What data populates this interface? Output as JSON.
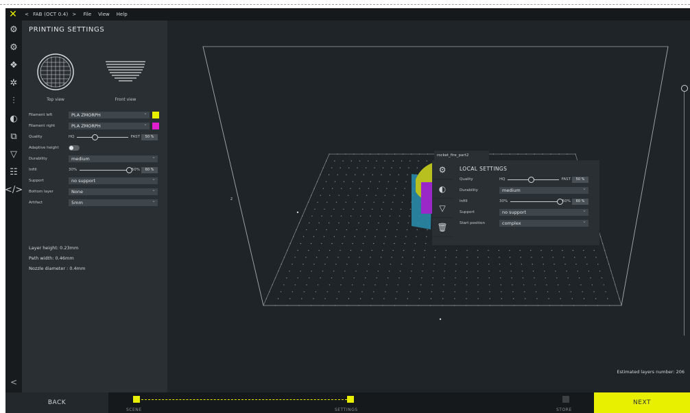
{
  "menubar": {
    "crumb_prefix": "<",
    "project": "FAB (OCT 0.4)",
    "crumb_sep": ">",
    "menus": [
      "File",
      "View",
      "Help"
    ]
  },
  "rail": {
    "icons": [
      "gear-icon",
      "gear-sub-icon",
      "model-settings-icon",
      "multi-gear-icon",
      "support-tree-icon",
      "palette-icon",
      "layers-icon",
      "funnel-icon",
      "network-icon",
      "code-icon"
    ],
    "collapse": "<"
  },
  "panel": {
    "title": "PRINTING SETTINGS",
    "top_view": "Top view",
    "front_view": "Front view",
    "filament_left_label": "Filament left",
    "filament_left_value": "PLA ZMORPH",
    "filament_left_color": "#e8f000",
    "filament_right_label": "Filament right",
    "filament_right_value": "PLA ZMORPH",
    "filament_right_color": "#e020d0",
    "quality_label": "Quality",
    "quality_hq": "HQ",
    "quality_fast": "FAST",
    "quality_value": 0.35,
    "quality_box": "50 %",
    "adaptive_label": "Adaptive height",
    "durability_label": "Durability",
    "durability_value": "medium",
    "infill_label": "Infill",
    "infill_min": "30%",
    "infill_max": "50%",
    "infill_value": 1.0,
    "infill_box": "60 %",
    "support_label": "Support",
    "support_value": "no support",
    "bottom_label": "Bottom layer",
    "bottom_value": "None",
    "artifact_label": "Artifact",
    "artifact_value": "5mm",
    "layer_height": "Layer height: 0.23mm",
    "path_width": "Path width: 0.46mm",
    "nozzle": "Nozzle diameter : 0.4mm"
  },
  "scene": {
    "estimated": "Estimated layers number: 206",
    "origin_marker": "z"
  },
  "local": {
    "object_name": "rocket_fire_part2",
    "title": "LOCAL SETTINGS",
    "quality_label": "Quality",
    "quality_hq": "HQ",
    "quality_fast": "FAST",
    "quality_value": 0.45,
    "quality_box": "50 %",
    "durability_label": "Durability",
    "durability_value": "medium",
    "infill_label": "Infill",
    "infill_min": "30%",
    "infill_max": "50%",
    "infill_value": 1.0,
    "infill_box": "60 %",
    "support_label": "Support",
    "support_value": "no support",
    "start_label": "Start position",
    "start_value": "complex",
    "tools": [
      "gear-icon",
      "palette-icon",
      "funnel-icon",
      "trash-icon"
    ]
  },
  "bottombar": {
    "back": "BACK",
    "next": "NEXT",
    "steps": [
      "SCENE",
      "SETTINGS",
      "STORE"
    ]
  }
}
